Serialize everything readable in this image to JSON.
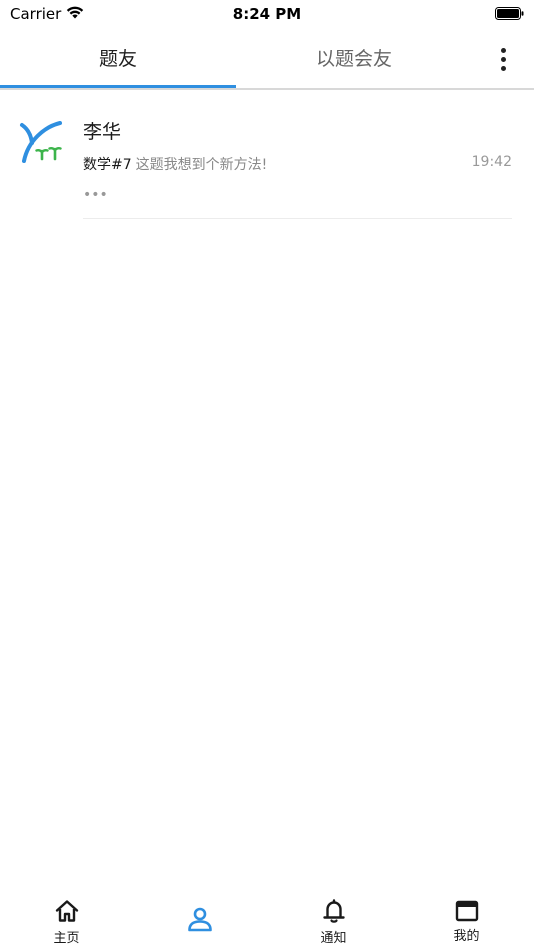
{
  "status_bar": {
    "carrier": "Carrier",
    "time": "8:24 PM"
  },
  "tabs": [
    {
      "label": "题友",
      "active": true
    },
    {
      "label": "以题会友",
      "active": false
    }
  ],
  "colors": {
    "accent": "#2f8fe0",
    "avatar_blue": "#2f8fe0",
    "avatar_green": "#3cb44b"
  },
  "conversations": [
    {
      "name": "李华",
      "tag": "数学#7",
      "message": "这题我想到个新方法!",
      "time": "19:42",
      "more": "•••"
    }
  ],
  "bottom_nav": [
    {
      "label": "主页",
      "icon": "home-icon"
    },
    {
      "label": "",
      "icon": "person-icon",
      "active": true
    },
    {
      "label": "通知",
      "icon": "bell-icon"
    },
    {
      "label": "我的",
      "icon": "window-icon"
    }
  ]
}
